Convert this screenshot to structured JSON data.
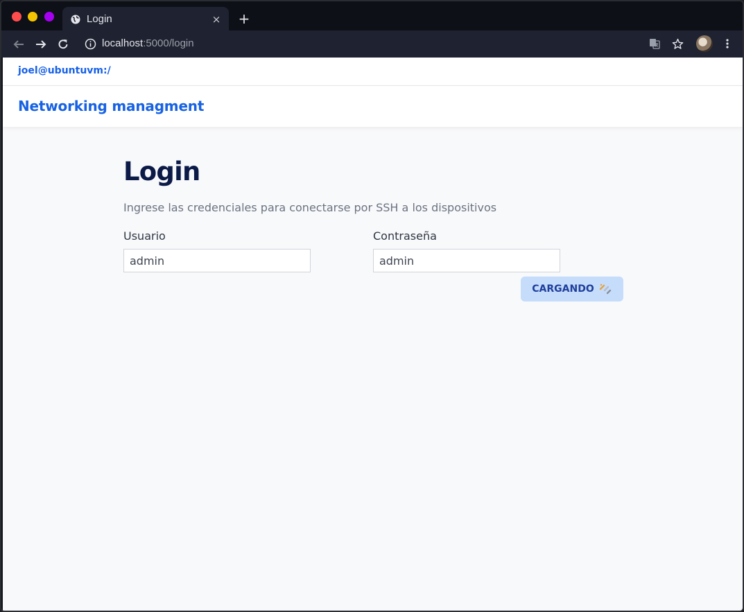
{
  "browser": {
    "tab_title": "Login",
    "tab_close": "×",
    "new_tab": "+",
    "url_host": "localhost",
    "url_path": ":5000/login",
    "traffic_colors": {
      "close": "#ff4d4d",
      "minimize": "#f5c400",
      "maximize": "#a600f0"
    }
  },
  "app": {
    "terminal_user": "joel@ubuntuvm:/",
    "brand": "Networking managment"
  },
  "login": {
    "heading": "Login",
    "subtitle": "Ingrese las credenciales para conectarse por SSH a los dispositivos",
    "username_label": "Usuario",
    "username_value": "admin",
    "password_label": "Contraseña",
    "password_value": "admin",
    "submit_label": "CARGANDO"
  },
  "icons": {
    "tab": "globe-icon",
    "back": "arrow-left-icon",
    "forward": "arrow-right-icon",
    "reload": "reload-icon",
    "site_info": "info-icon",
    "translate": "translate-icon",
    "bookmark": "star-icon",
    "profile": "avatar",
    "menu": "kebab-menu-icon",
    "loading": "sparkle-icon"
  },
  "colors": {
    "accent": "#1762e3",
    "heading": "#0c1a48",
    "button_bg": "#c5dcfb",
    "button_text": "#1f3f9c"
  }
}
